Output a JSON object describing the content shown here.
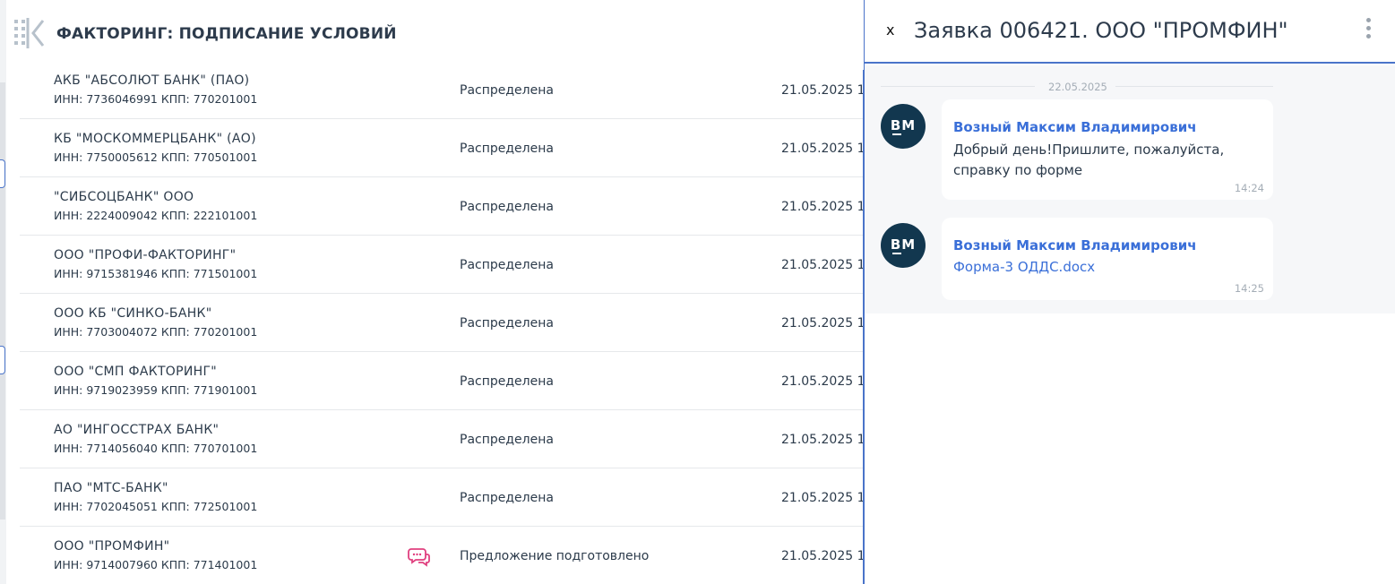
{
  "header": {
    "title": "ФАКТОРИНГ: ПОДПИСАНИЕ УСЛОВИЙ",
    "collapse_icon": "sidebar-collapse-icon"
  },
  "rows": [
    {
      "name": "АКБ \"АБСОЛЮТ БАНК\" (ПАО)",
      "ids": "ИНН: 7736046991 КПП: 770201001",
      "status": "Распределена",
      "date": "21.05.2025 1"
    },
    {
      "name": "КБ \"МОСКОММЕРЦБАНК\" (АО)",
      "ids": "ИНН: 7750005612 КПП: 770501001",
      "status": "Распределена",
      "date": "21.05.2025 1"
    },
    {
      "name": "\"СИБСОЦБАНК\" ООО",
      "ids": "ИНН: 2224009042 КПП: 222101001",
      "status": "Распределена",
      "date": "21.05.2025 1"
    },
    {
      "name": "ООО \"ПРОФИ-ФАКТОРИНГ\"",
      "ids": "ИНН: 9715381946 КПП: 771501001",
      "status": "Распределена",
      "date": "21.05.2025 1"
    },
    {
      "name": "ООО КБ \"СИНКО-БАНК\"",
      "ids": "ИНН: 7703004072 КПП: 770201001",
      "status": "Распределена",
      "date": "21.05.2025 1"
    },
    {
      "name": "ООО \"СМП ФАКТОРИНГ\"",
      "ids": "ИНН: 9719023959 КПП: 771901001",
      "status": "Распределена",
      "date": "21.05.2025 1"
    },
    {
      "name": "АО \"ИНГОССТРАХ БАНК\"",
      "ids": "ИНН: 7714056040 КПП: 770701001",
      "status": "Распределена",
      "date": "21.05.2025 1"
    },
    {
      "name": "ПАО \"МТС-БАНК\"",
      "ids": "ИНН: 7702045051 КПП: 772501001",
      "status": "Распределена",
      "date": "21.05.2025 1"
    },
    {
      "name": "ООО \"ПРОМФИН\"",
      "ids": "ИНН: 9714007960 КПП: 771401001",
      "status": "Предложение подготовлено",
      "date": "21.05.2025 1",
      "chat_icon": "chat-bubble-icon"
    }
  ],
  "chat": {
    "close_label": "x",
    "title": "Заявка 006421. ООО \"ПРОМФИН\"",
    "menu_icon": "kebab-menu-icon",
    "date_separator": "22.05.2025",
    "messages": [
      {
        "avatar": "BM",
        "sender": "Возный Максим Владимирович",
        "text": "Добрый день!Пришлите, пожалуйста, справку по форме",
        "time": "14:24"
      },
      {
        "avatar": "BM",
        "sender": "Возный Максим Владимирович",
        "attachment": "Форма-3 ОДДС.docx",
        "time": "14:25"
      }
    ]
  },
  "colors": {
    "accent": "#4a74c9",
    "link": "#3a6fd8",
    "avatar_bg": "#12374f",
    "chat_icon": "#e0407f"
  }
}
